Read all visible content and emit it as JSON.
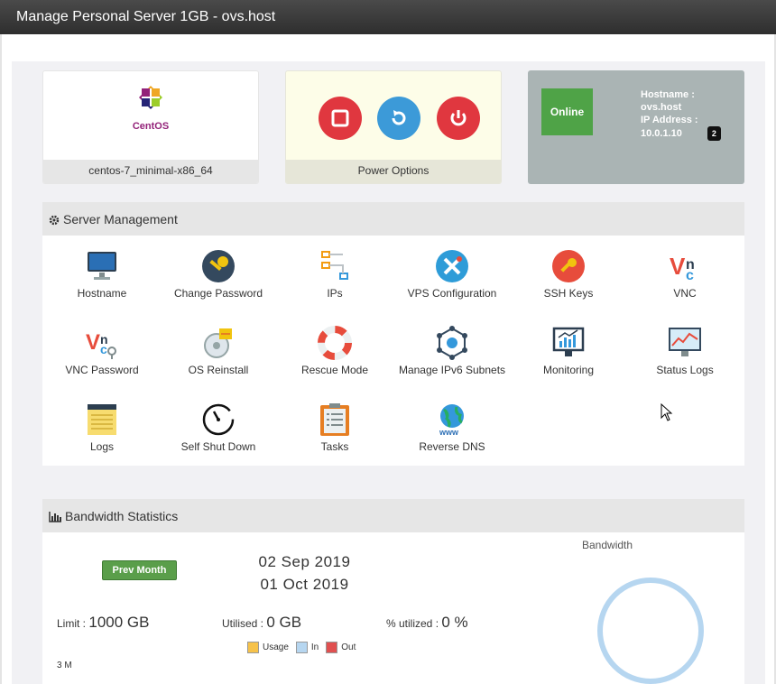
{
  "window": {
    "title": "Manage Personal Server 1GB - ovs.host"
  },
  "os": {
    "logo_text": "CentOS",
    "name": "centos-7_minimal-x86_64"
  },
  "power": {
    "label": "Power Options",
    "buttons": [
      {
        "name": "stop",
        "color": "#e0373f"
      },
      {
        "name": "restart",
        "color": "#3c9ad8"
      },
      {
        "name": "power-off",
        "color": "#e0373f"
      }
    ]
  },
  "status": {
    "state": "Online",
    "hostname_label": "Hostname :",
    "hostname": "ovs.host",
    "ip_label": "IP Address :",
    "ip": "10.0.1.10",
    "ip_count": "2"
  },
  "server_management": {
    "title": "Server Management",
    "tools": [
      {
        "label": "Hostname",
        "icon": "monitor-icon"
      },
      {
        "label": "Change Password",
        "icon": "key-icon"
      },
      {
        "label": "IPs",
        "icon": "ips-icon"
      },
      {
        "label": "VPS Configuration",
        "icon": "wrench-icon"
      },
      {
        "label": "SSH Keys",
        "icon": "ssh-key-icon"
      },
      {
        "label": "VNC",
        "icon": "vnc-icon"
      },
      {
        "label": "VNC Password",
        "icon": "vnc-password-icon"
      },
      {
        "label": "OS Reinstall",
        "icon": "os-reinstall-icon"
      },
      {
        "label": "Rescue Mode",
        "icon": "lifebuoy-icon"
      },
      {
        "label": "Manage IPv6 Subnets",
        "icon": "network-icon"
      },
      {
        "label": "Monitoring",
        "icon": "monitoring-icon"
      },
      {
        "label": "Status Logs",
        "icon": "status-logs-icon"
      },
      {
        "label": "Logs",
        "icon": "notepad-icon"
      },
      {
        "label": "Self Shut Down",
        "icon": "timer-icon"
      },
      {
        "label": "Tasks",
        "icon": "clipboard-icon"
      },
      {
        "label": "Reverse DNS",
        "icon": "globe-icon"
      }
    ]
  },
  "bandwidth": {
    "title": "Bandwidth Statistics",
    "prev_button": "Prev Month",
    "date_from": "02 Sep 2019",
    "date_to": "01 Oct 2019",
    "limit_label": "Limit :",
    "limit_value": "1000 GB",
    "utilised_label": "Utilised :",
    "utilised_value": "0 GB",
    "percent_label": "% utilized :",
    "percent_value": "0 %",
    "legend": [
      {
        "label": "Usage",
        "color": "#f6c24a"
      },
      {
        "label": "In",
        "color": "#b6d6f0"
      },
      {
        "label": "Out",
        "color": "#e05050"
      }
    ],
    "y_tick": "3 M",
    "chart_title": "Bandwidth"
  }
}
